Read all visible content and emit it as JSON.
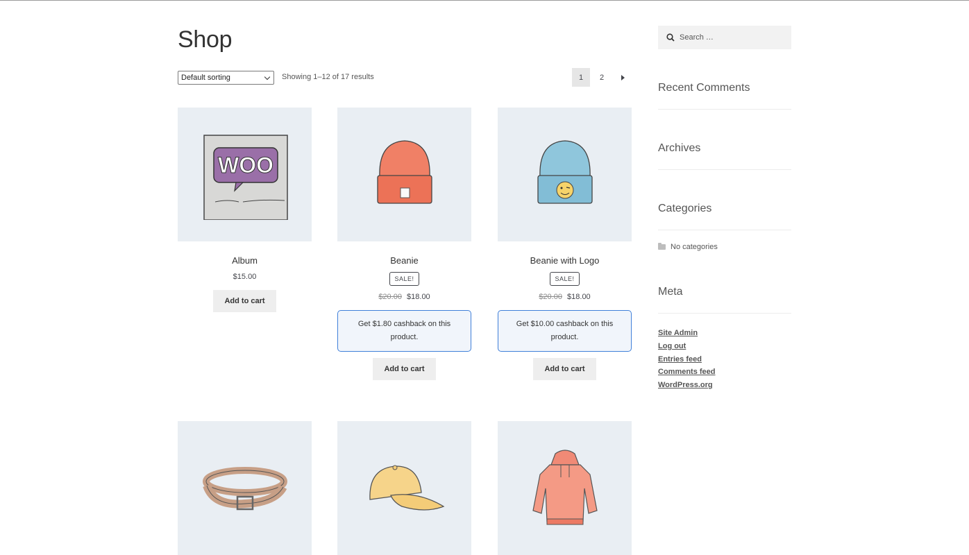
{
  "shop": {
    "title": "Shop",
    "sorting": "Default sorting",
    "result_count": "Showing 1–12 of 17 results",
    "pages": [
      "1",
      "2"
    ]
  },
  "products": [
    {
      "name": "Album",
      "price": "$15.00",
      "button": "Add to cart",
      "image_icon": "album-icon"
    },
    {
      "name": "Beanie",
      "sale_badge": "SALE!",
      "old_price": "$20.00",
      "price": "$18.00",
      "cashback": "Get $1.80 cashback on this product.",
      "button": "Add to cart",
      "image_icon": "beanie-icon"
    },
    {
      "name": "Beanie with Logo",
      "sale_badge": "SALE!",
      "old_price": "$20.00",
      "price": "$18.00",
      "cashback": "Get $10.00 cashback on this product.",
      "button": "Add to cart",
      "image_icon": "beanie-logo-icon"
    },
    {
      "image_icon": "belt-icon"
    },
    {
      "image_icon": "cap-icon"
    },
    {
      "image_icon": "hoodie-icon"
    }
  ],
  "sidebar": {
    "search_placeholder": "Search …",
    "recent_comments": "Recent Comments",
    "archives": "Archives",
    "categories": "Categories",
    "no_categories": "No categories",
    "meta": "Meta",
    "meta_links": [
      "Site Admin",
      "Log out",
      "Entries feed",
      "Comments feed",
      "WordPress.org"
    ]
  },
  "colors": {
    "accent_border": "#3f7fd9",
    "image_bg": "#e9eef3",
    "button_bg": "#eeeeee"
  }
}
